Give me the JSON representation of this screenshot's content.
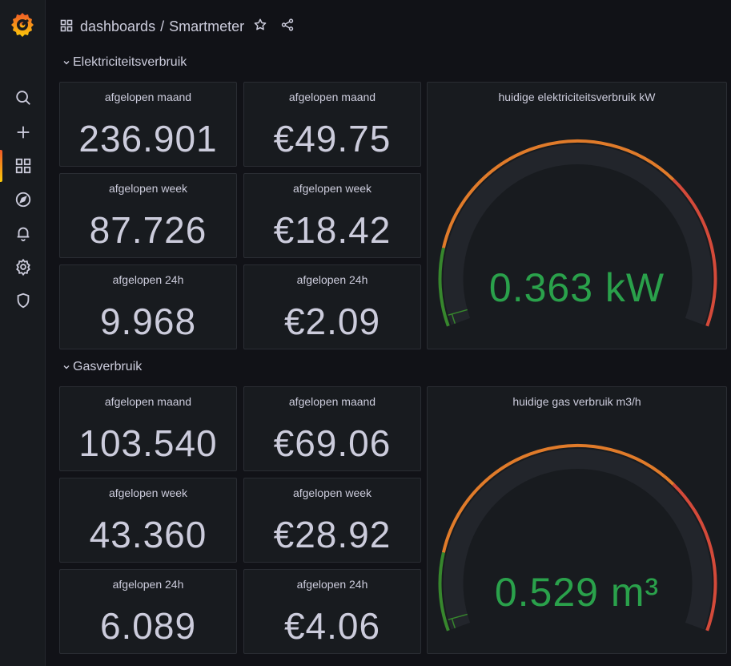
{
  "header": {
    "breadcrumb_root": "dashboards",
    "separator": "/",
    "breadcrumb_current": "Smartmeter"
  },
  "sidebar": {
    "items": [
      {
        "icon": "search-icon"
      },
      {
        "icon": "plus-icon"
      },
      {
        "icon": "dashboards-icon",
        "active": true
      },
      {
        "icon": "compass-icon"
      },
      {
        "icon": "bell-icon"
      },
      {
        "icon": "gear-icon"
      },
      {
        "icon": "shield-icon"
      }
    ]
  },
  "rows": [
    {
      "title": "Elektriciteitsverbruik",
      "stats": [
        {
          "title": "afgelopen maand",
          "value": "236.901"
        },
        {
          "title": "afgelopen maand",
          "value": "€49.75"
        },
        {
          "title": "afgelopen week",
          "value": "87.726"
        },
        {
          "title": "afgelopen week",
          "value": "€18.42"
        },
        {
          "title": "afgelopen 24h",
          "value": "9.968"
        },
        {
          "title": "afgelopen 24h",
          "value": "€2.09"
        }
      ],
      "gauge": {
        "title": "huidige elektriciteitsverbruik kW",
        "value": "0.363 kW",
        "fraction": 0.02
      }
    },
    {
      "title": "Gasverbruik",
      "stats": [
        {
          "title": "afgelopen maand",
          "value": "103.540"
        },
        {
          "title": "afgelopen maand",
          "value": "€69.06"
        },
        {
          "title": "afgelopen week",
          "value": "43.360"
        },
        {
          "title": "afgelopen week",
          "value": "€28.92"
        },
        {
          "title": "afgelopen 24h",
          "value": "6.089"
        },
        {
          "title": "afgelopen 24h",
          "value": "€4.06"
        }
      ],
      "gauge": {
        "title": "huidige gas verbruik m3/h",
        "value": "0.529 m³",
        "fraction": 0.02
      }
    }
  ],
  "colors": {
    "green": "#37872d",
    "orange": "#e07b2a",
    "red": "#d44a3a",
    "value_green": "#2aa14b"
  }
}
